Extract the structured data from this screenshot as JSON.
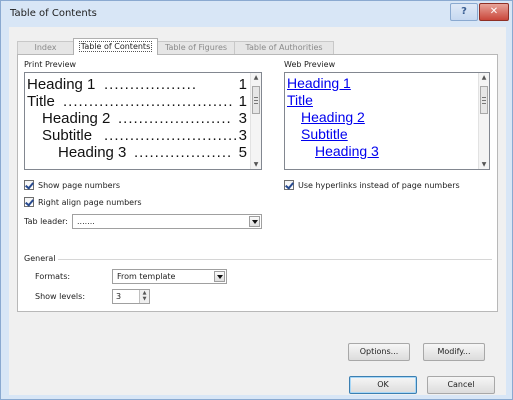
{
  "window": {
    "title": "Table of Contents",
    "help_label": "?",
    "close_label": "✕"
  },
  "tabs": [
    {
      "label": "Index",
      "active": false
    },
    {
      "label": "Table of Contents",
      "active": true
    },
    {
      "label": "Table of Figures",
      "active": false
    },
    {
      "label": "Table of Authorities",
      "active": false
    }
  ],
  "print_preview": {
    "label": "Print Preview",
    "lines": [
      {
        "text": "Heading 1",
        "leader": "..................",
        "page": "1"
      },
      {
        "text": "Title",
        "leader": ".................................",
        "page": "1"
      },
      {
        "text": "Heading 2",
        "leader": "......................",
        "page": "3"
      },
      {
        "text": "Subtitle",
        "leader": "..........................",
        "page": "3"
      },
      {
        "text": "Heading 3",
        "leader": "...................",
        "page": "5"
      }
    ]
  },
  "web_preview": {
    "label": "Web Preview",
    "lines": [
      "Heading 1",
      "Title",
      "Heading 2",
      "Subtitle",
      "Heading 3"
    ]
  },
  "options": {
    "show_page_numbers": {
      "label": "Show page numbers",
      "checked": true
    },
    "right_align": {
      "label": "Right align page numbers",
      "checked": true
    },
    "use_hyperlinks": {
      "label": "Use hyperlinks instead of page numbers",
      "checked": true
    },
    "tab_leader_label": "Tab leader:",
    "tab_leader_value": "......."
  },
  "general": {
    "label": "General",
    "formats_label": "Formats:",
    "formats_value": "From template",
    "show_levels_label": "Show levels:",
    "show_levels_value": "3"
  },
  "buttons": {
    "options": "Options...",
    "modify": "Modify...",
    "ok": "OK",
    "cancel": "Cancel"
  }
}
